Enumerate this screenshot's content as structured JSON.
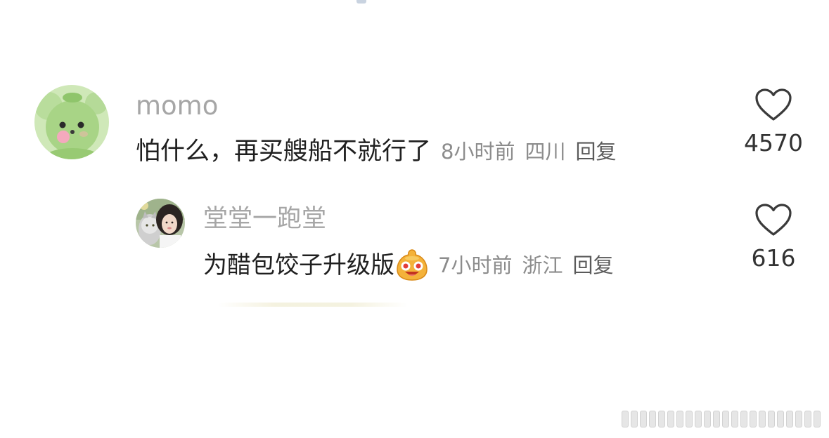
{
  "comments": [
    {
      "username": "momo",
      "text": "怕什么，再买艘船不就行了",
      "time": "8小时前",
      "location": "四川",
      "reply_label": "回复",
      "likes": "4570",
      "avatar_icon": "green-plush-avatar",
      "like_icon": "heart-outline-icon"
    },
    {
      "username": "堂堂一跑堂",
      "text": "为醋包饺子升级版",
      "emoji_icon": "laughing-bun-emoji",
      "time": "7小时前",
      "location": "浙江",
      "reply_label": "回复",
      "likes": "616",
      "avatar_icon": "girl-with-cat-avatar",
      "like_icon": "heart-outline-icon"
    }
  ],
  "colors": {
    "username": "#a6a6a6",
    "content": "#1f1f1f",
    "meta": "#8c8c8c",
    "like_count": "#333333"
  }
}
